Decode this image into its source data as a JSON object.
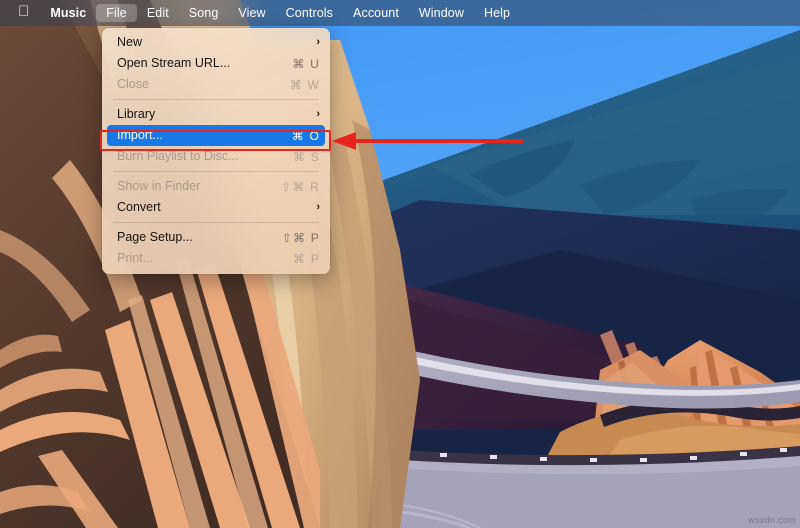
{
  "menubar": {
    "apple_icon": "apple-logo",
    "items": [
      {
        "label": "Music",
        "bold": true,
        "active": false
      },
      {
        "label": "File",
        "bold": false,
        "active": true
      },
      {
        "label": "Edit",
        "bold": false,
        "active": false
      },
      {
        "label": "Song",
        "bold": false,
        "active": false
      },
      {
        "label": "View",
        "bold": false,
        "active": false
      },
      {
        "label": "Controls",
        "bold": false,
        "active": false
      },
      {
        "label": "Account",
        "bold": false,
        "active": false
      },
      {
        "label": "Window",
        "bold": false,
        "active": false
      },
      {
        "label": "Help",
        "bold": false,
        "active": false
      }
    ]
  },
  "file_menu": {
    "rows": [
      {
        "type": "item",
        "label": "New",
        "shortcut": "",
        "submenu": true,
        "disabled": false,
        "selected": false
      },
      {
        "type": "item",
        "label": "Open Stream URL...",
        "shortcut": "⌘ U",
        "submenu": false,
        "disabled": false,
        "selected": false
      },
      {
        "type": "item",
        "label": "Close",
        "shortcut": "⌘ W",
        "submenu": false,
        "disabled": true,
        "selected": false
      },
      {
        "type": "sep"
      },
      {
        "type": "item",
        "label": "Library",
        "shortcut": "",
        "submenu": true,
        "disabled": false,
        "selected": false
      },
      {
        "type": "item",
        "label": "Import...",
        "shortcut": "⌘ O",
        "submenu": false,
        "disabled": false,
        "selected": true
      },
      {
        "type": "item",
        "label": "Burn Playlist to Disc...",
        "shortcut": "⌘ S",
        "submenu": false,
        "disabled": true,
        "selected": false
      },
      {
        "type": "sep"
      },
      {
        "type": "item",
        "label": "Show in Finder",
        "shortcut": "⇧⌘ R",
        "submenu": false,
        "disabled": true,
        "selected": false
      },
      {
        "type": "item",
        "label": "Convert",
        "shortcut": "",
        "submenu": true,
        "disabled": false,
        "selected": false
      },
      {
        "type": "sep"
      },
      {
        "type": "item",
        "label": "Page Setup...",
        "shortcut": "⇧⌘ P",
        "submenu": false,
        "disabled": false,
        "selected": false
      },
      {
        "type": "item",
        "label": "Print...",
        "shortcut": "⌘ P",
        "submenu": false,
        "disabled": true,
        "selected": false
      }
    ]
  },
  "annotation": {
    "highlight_color": "#e8251c",
    "arrow_color": "#e8251c",
    "target": "Import..."
  },
  "watermark": {
    "text": "wsxdn.com"
  },
  "colors": {
    "menubar_bg": "#343f54",
    "menu_bg": "#f3e1cd",
    "selection_blue": "#1878e8",
    "sky_blue": "#4da2f5",
    "canyon_brown": "#4a352c",
    "canyon_tan": "#e8a87c",
    "cliff_sand": "#dfb887",
    "mountain_purple": "#3c2340",
    "ridge_teal": "#2e6b8e"
  }
}
